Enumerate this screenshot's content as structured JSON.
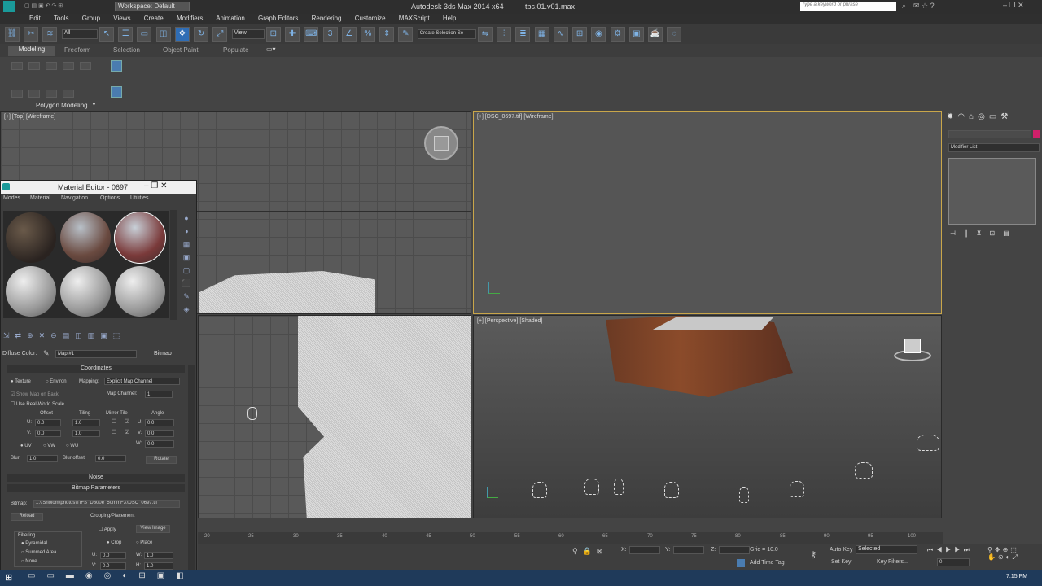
{
  "title": {
    "app": "Autodesk 3ds Max  2014 x64",
    "file": "tbs.01.v01.max",
    "workspace": "Workspace: Default",
    "search_placeholder": "Type a keyword or phrase"
  },
  "menu": [
    "Edit",
    "Tools",
    "Group",
    "Views",
    "Create",
    "Modifiers",
    "Animation",
    "Graph Editors",
    "Rendering",
    "Customize",
    "MAXScript",
    "Help"
  ],
  "toolbar": {
    "selection_filter": "All",
    "ref_coord": "View",
    "named_selection": "Create Selection Se"
  },
  "ribbon": {
    "tabs": [
      "Modeling",
      "Freeform",
      "Selection",
      "Object Paint",
      "Populate"
    ],
    "panel": "Polygon Modeling"
  },
  "viewports": {
    "top": "[+] [Top] [Wireframe]",
    "camera": "[+] [DSC_0697.tif] [Wireframe]",
    "perspective": "[+] [Perspective] [Shaded]"
  },
  "command_panel": {
    "modifier_list": "Modifier List"
  },
  "material_editor": {
    "title": "Material Editor - 0697",
    "menus": [
      "Modes",
      "Material",
      "Navigation",
      "Options",
      "Utilities"
    ],
    "diffuse_label": "Diffuse Color:",
    "map_name": "Map #1",
    "map_type": "Bitmap",
    "coordinates": {
      "header": "Coordinates",
      "texture": "Texture",
      "environ": "Environ",
      "mapping_label": "Mapping:",
      "mapping_value": "Explicit Map Channel",
      "show_map_on_back": "Show Map on Back",
      "map_channel_label": "Map Channel:",
      "map_channel": "1",
      "use_real_world": "Use Real-World Scale",
      "offset": "Offset",
      "tiling": "Tiling",
      "mirror_tile": "Mirror Tile",
      "angle": "Angle",
      "u_label": "U:",
      "v_label": "V:",
      "w_label": "W:",
      "u_offset": "0.0",
      "v_offset": "0.0",
      "u_tiling": "1.0",
      "v_tiling": "1.0",
      "u_angle": "0.0",
      "v_angle": "0.0",
      "w_angle": "0.0",
      "uv": "UV",
      "vw": "VW",
      "wu": "WU",
      "blur_label": "Blur:",
      "blur": "1.0",
      "blur_offset_label": "Blur offset:",
      "blur_offset": "0.0",
      "rotate": "Rotate"
    },
    "noise_header": "Noise",
    "bitmap_params": {
      "header": "Bitmap Parameters",
      "bitmap_label": "Bitmap:",
      "bitmap_path": "...\\ Sholom\\photos\\TIFS_D800e_50mmFX\\DSC_0697.tif",
      "reload": "Reload",
      "cropping": "Cropping/Placement",
      "apply": "Apply",
      "view_image": "View Image",
      "filtering": "Filtering",
      "pyramidal": "Pyramidal",
      "summed_area": "Summed Area",
      "none": "None",
      "crop": "Crop",
      "place": "Place",
      "u_label": "U:",
      "v_label": "V:",
      "w_label": "W:",
      "h_label": "H:",
      "u_val": "0.0",
      "v_val": "0.0",
      "w_val": "1.0",
      "h_val": "1.0"
    }
  },
  "trackbar": {
    "ticks": [
      "20",
      "25",
      "30",
      "35",
      "40",
      "45",
      "50",
      "55",
      "60",
      "65",
      "70",
      "75",
      "80",
      "85",
      "90",
      "95",
      "100"
    ]
  },
  "status": {
    "x_label": "X:",
    "y_label": "Y:",
    "z_label": "Z:",
    "grid": "Grid = 10.0",
    "auto_key": "Auto Key",
    "selected": "Selected",
    "set_key": "Set Key",
    "key_filters": "Key Filters...",
    "add_time_tag": "Add Time Tag",
    "frame": "0"
  },
  "taskbar": {
    "time": "7:15 PM"
  }
}
